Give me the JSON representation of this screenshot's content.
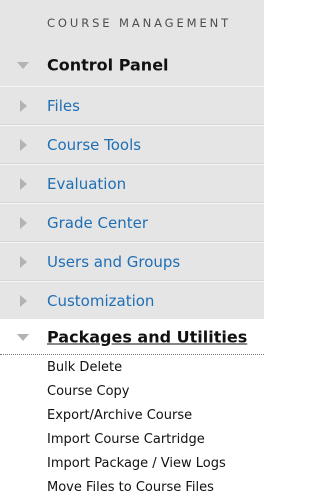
{
  "header": {
    "title": "COURSE MANAGEMENT"
  },
  "control_panel": {
    "label": "Control Panel",
    "expanded": true
  },
  "items": [
    {
      "label": "Files",
      "icon": "triangle-right-icon"
    },
    {
      "label": "Course Tools",
      "icon": "triangle-right-icon"
    },
    {
      "label": "Evaluation",
      "icon": "triangle-right-icon"
    },
    {
      "label": "Grade Center",
      "icon": "triangle-right-icon"
    },
    {
      "label": "Users and Groups",
      "icon": "triangle-right-icon"
    },
    {
      "label": "Customization",
      "icon": "triangle-right-icon"
    }
  ],
  "packages": {
    "label": "Packages and Utilities",
    "expanded": true,
    "subitems": [
      "Bulk Delete",
      "Course Copy",
      "Export/Archive Course",
      "Import Course Cartridge",
      "Import Package / View Logs",
      "Move Files to Course Files"
    ]
  },
  "colors": {
    "link": "#1f6fb5",
    "row_bg": "#e5e5e5",
    "triangle": "#b3b3b3",
    "text_dark": "#111111"
  }
}
